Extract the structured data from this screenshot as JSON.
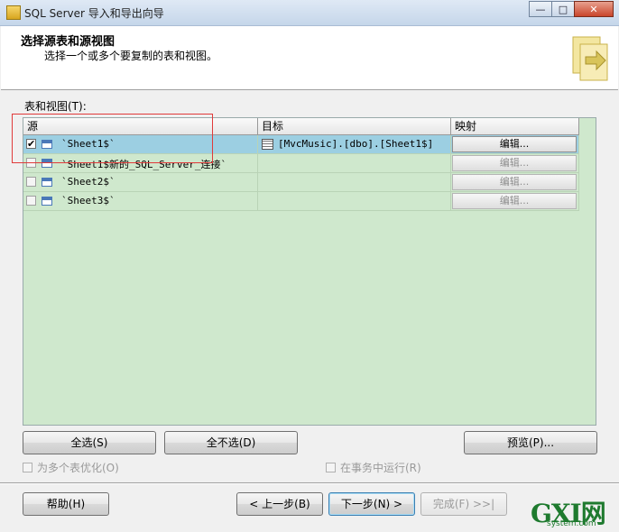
{
  "window": {
    "title": "SQL Server 导入和导出向导",
    "controls": {
      "minimize": "—",
      "maximize": "□",
      "close": "✕"
    }
  },
  "header": {
    "title": "选择源表和源视图",
    "subtitle": "选择一个或多个要复制的表和视图。"
  },
  "tables_label": "表和视图(T):",
  "grid": {
    "columns": [
      "源",
      "目标",
      "映射"
    ],
    "rows": [
      {
        "checked": true,
        "source": "`Sheet1$`",
        "destination": "[MvcMusic].[dbo].[Sheet1$]",
        "mapping": "编辑...",
        "selected": true,
        "mapping_enabled": true
      },
      {
        "checked": false,
        "source": "`Sheet1$新的_SQL_Server_连接`",
        "destination": "",
        "mapping": "编辑...",
        "selected": false,
        "mapping_enabled": false
      },
      {
        "checked": false,
        "source": "`Sheet2$`",
        "destination": "",
        "mapping": "编辑...",
        "selected": false,
        "mapping_enabled": false
      },
      {
        "checked": false,
        "source": "`Sheet3$`",
        "destination": "",
        "mapping": "编辑...",
        "selected": false,
        "mapping_enabled": false
      }
    ]
  },
  "actions": {
    "select_all": "全选(S)",
    "deselect_all": "全不选(D)",
    "preview": "预览(P)..."
  },
  "options": {
    "optimize_multiple": "为多个表优化(O)",
    "run_in_transaction": "在事务中运行(R)"
  },
  "footer": {
    "help": "帮助(H)",
    "back": "< 上一步(B)",
    "next": "下一步(N) >",
    "finish": "完成(F) >>|"
  },
  "watermark": {
    "big": "GXI网",
    "small": "system.com"
  },
  "colors": {
    "grid_bg": "#cfe8cd",
    "selected_row": "#9ccfe2",
    "annotation_box": "#e03a3a"
  }
}
